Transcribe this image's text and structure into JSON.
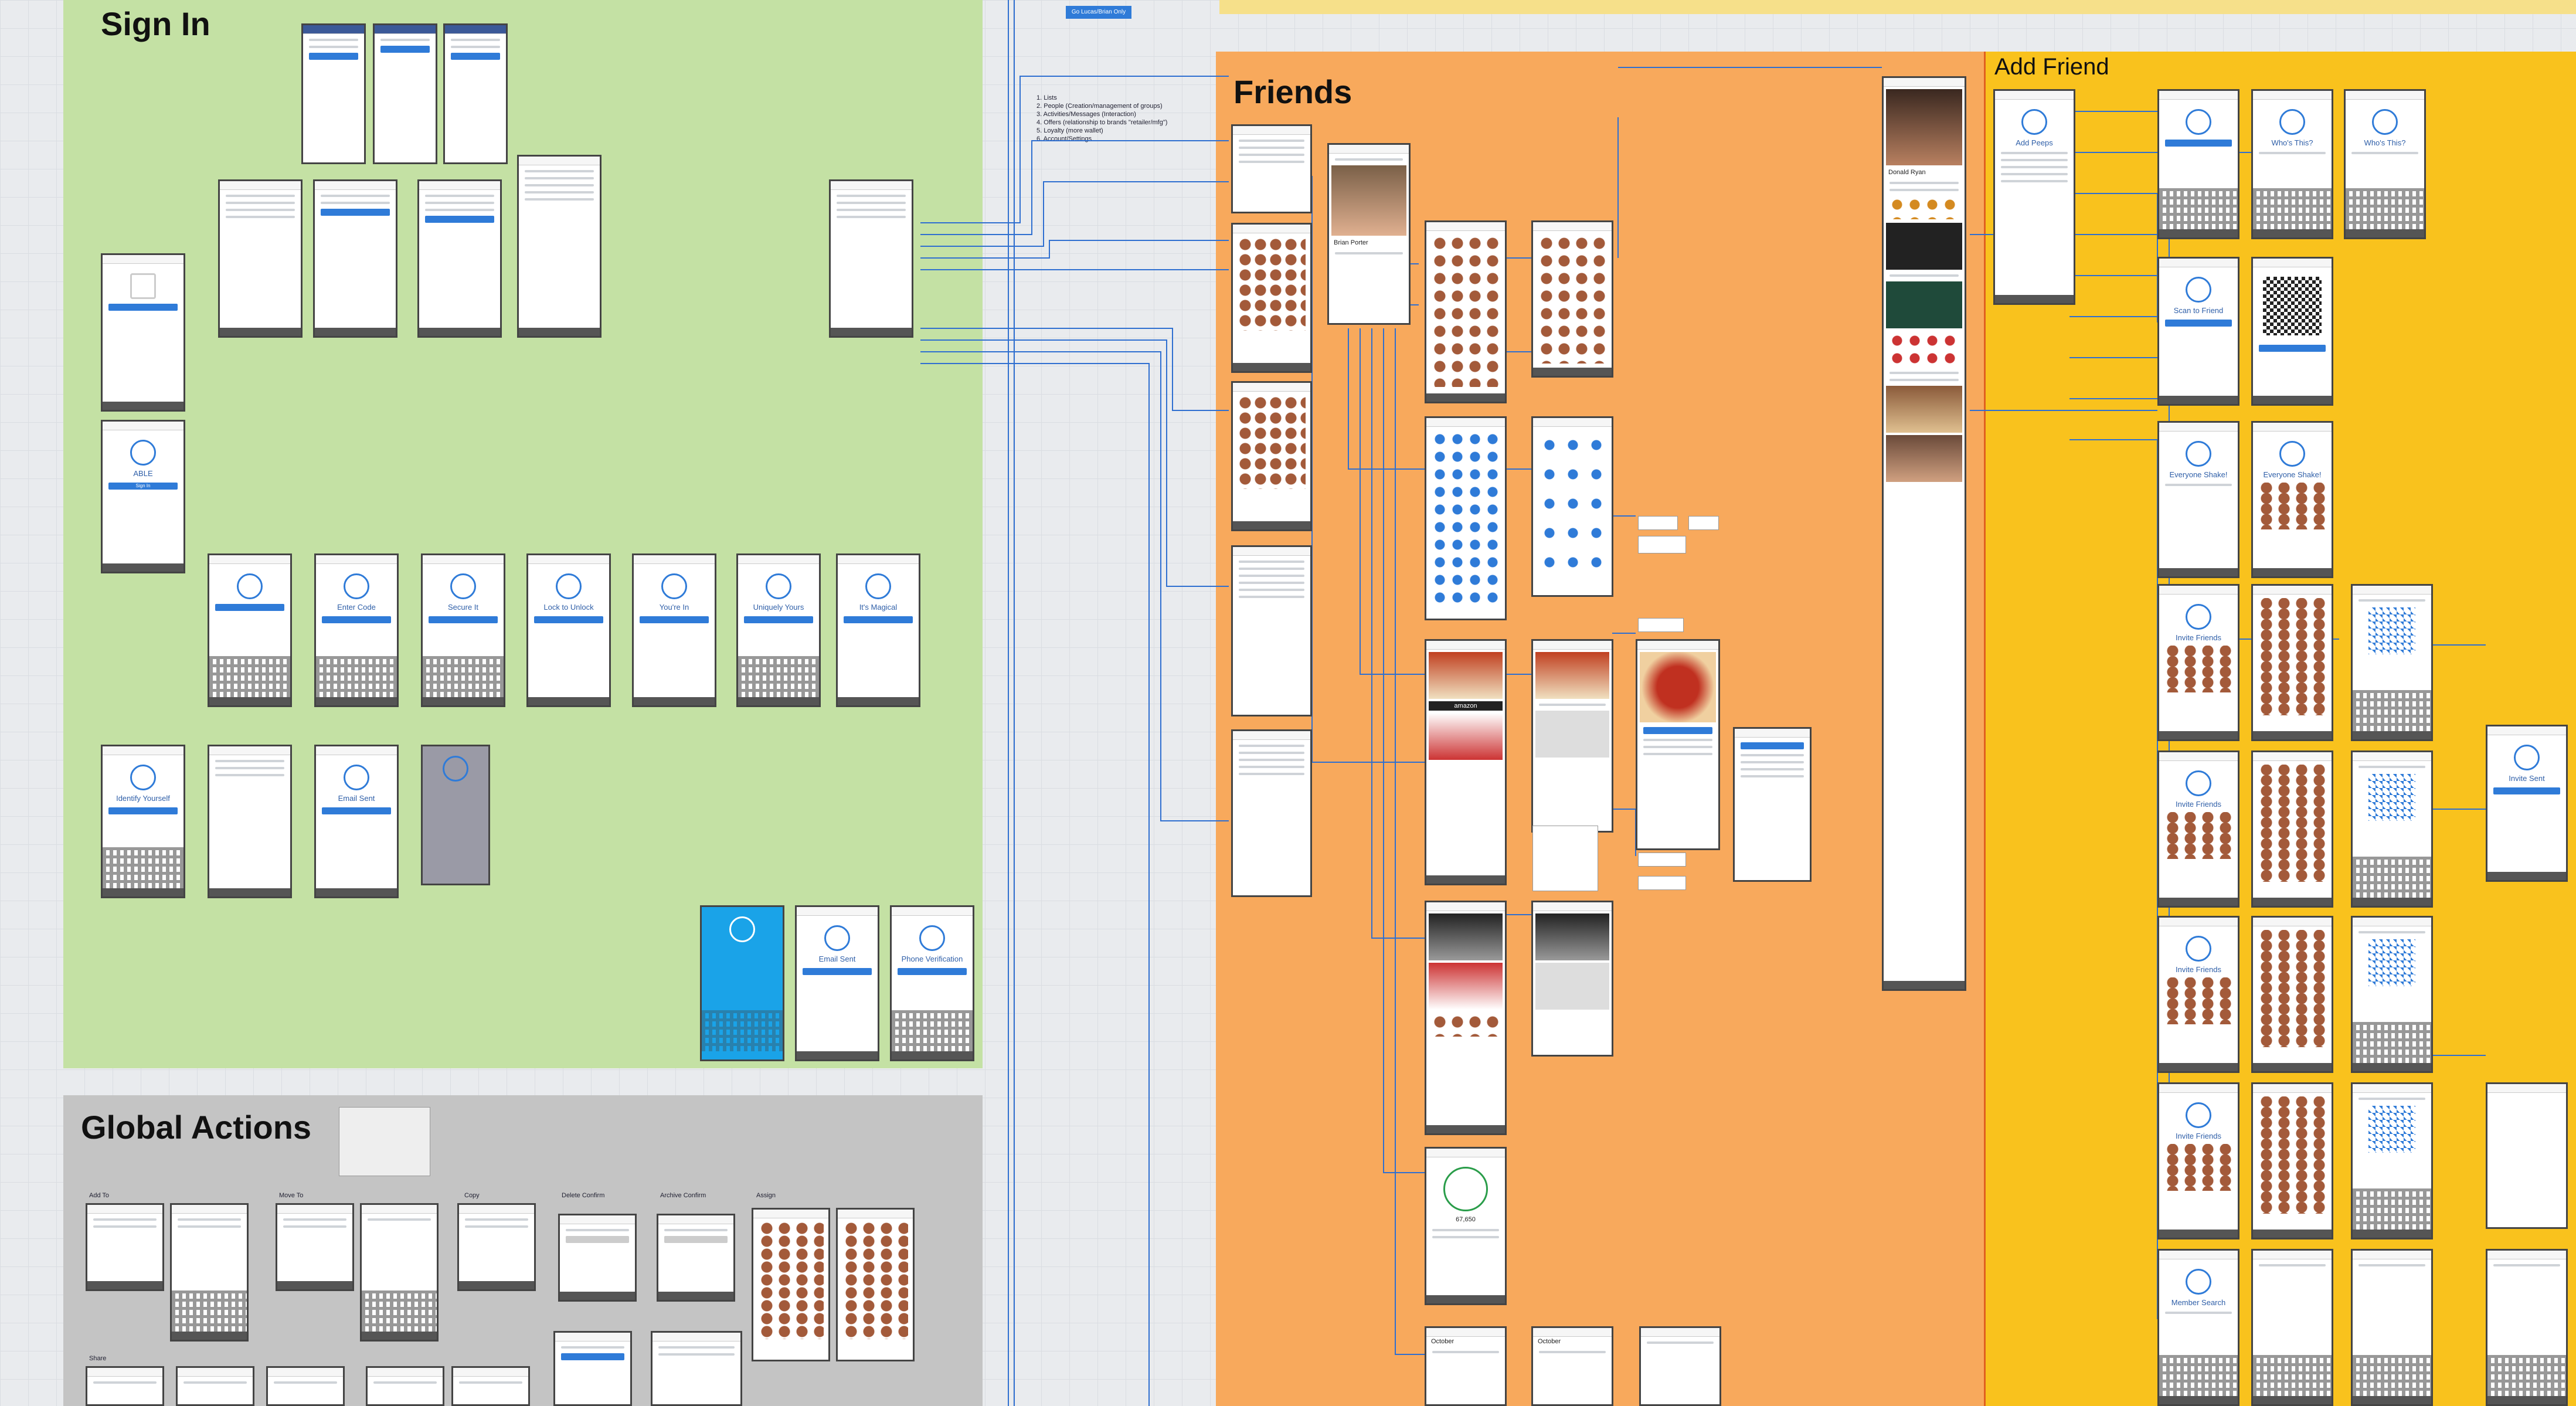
{
  "sections": {
    "sign_in": {
      "title": "Sign In",
      "color": "#c4e1a4"
    },
    "global_actions": {
      "title": "Global Actions",
      "color": "#c4c4c4"
    },
    "friends": {
      "title": "Friends",
      "color": "#f8a95c"
    },
    "add_friend": {
      "title": "Add Friend",
      "color": "#f9c21d"
    }
  },
  "top_button_label": "Go Lucas/Brian Only",
  "notes": {
    "list": [
      "1. Lists",
      "2. People (Creation/management of groups)",
      "3. Activities/Messages (Interaction)",
      "4. Offers (relationship to brands \"retailer/mfg\")",
      "5. Loyalty (more wallet)",
      "6. Account/Settings"
    ]
  },
  "sign_in_screens": [
    {
      "title": "",
      "logo": "",
      "label": ""
    },
    {
      "title": "",
      "logo": "ABLE",
      "label": "Sign In"
    },
    {
      "title": "Enter Code",
      "logo": "",
      "label": ""
    },
    {
      "title": "Secure It",
      "logo": "",
      "label": ""
    },
    {
      "title": "Lock to Unlock",
      "logo": "",
      "label": ""
    },
    {
      "title": "You're In",
      "logo": "",
      "label": ""
    },
    {
      "title": "Uniquely Yours",
      "logo": "",
      "label": ""
    },
    {
      "title": "It's Magical",
      "logo": "",
      "label": ""
    },
    {
      "title": "Identify Yourself",
      "logo": "",
      "label": ""
    },
    {
      "title": "Email Sent",
      "logo": "",
      "label": ""
    },
    {
      "title": "Email Sent",
      "logo": "",
      "label": ""
    },
    {
      "title": "Phone Verification",
      "logo": "",
      "label": ""
    }
  ],
  "global_action_labels": [
    "Add To",
    "Move To",
    "Copy",
    "Delete Confirm",
    "Archive Confirm",
    "Assign",
    "Share"
  ],
  "friends_labels": {
    "person_1": "Brian Porter",
    "person_2": "Donald Ryan",
    "gauge_value": "67,650",
    "month_1": "October",
    "month_2": "October",
    "brand_1": "amazon"
  },
  "add_friend_titles": [
    "Add Peeps",
    "Who's This?",
    "Who's This?",
    "Scan to Friend",
    "",
    "Everyone Shake!",
    "Everyone Shake!",
    "Invite Friends",
    "Invite Friends",
    "Invite Friends",
    "Invite Friends",
    "Invite Sent",
    "Member Search"
  ]
}
